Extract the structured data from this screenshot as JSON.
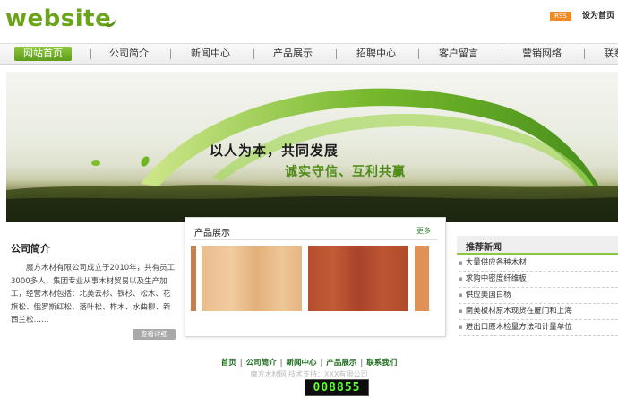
{
  "header": {
    "logo_text": "website",
    "rss_label": "RSS",
    "set_home": "设为首页"
  },
  "nav": {
    "items": [
      {
        "label": "网站首页",
        "active": true
      },
      {
        "label": "公司简介"
      },
      {
        "label": "新闻中心"
      },
      {
        "label": "产品展示"
      },
      {
        "label": "招聘中心"
      },
      {
        "label": "客户留言"
      },
      {
        "label": "营销网络"
      },
      {
        "label": "联系"
      }
    ]
  },
  "banner": {
    "slogan_main": "以人为本，共同发展",
    "slogan_sub": "诚实守信、互利共赢"
  },
  "about": {
    "title": "公司简介",
    "text": "魔方木材有限公司成立于2010年，共有员工3000多人，集团专业从事木材贸易以及生产加工，经营木材包括：北美云杉、铁杉、松木、花旗松、俄罗斯红松、落叶松、柞木、水曲柳、新西兰松……",
    "more_label": "查看详细"
  },
  "products": {
    "title": "产品展示",
    "more_label": "更多",
    "colors": {
      "wood_light": "#e8b884",
      "wood_red": "#b34c2c",
      "wood_orange": "#e0925a"
    }
  },
  "news": {
    "title": "推荐新闻",
    "items": [
      "大量供应各种木材",
      "求购中密度纤维板",
      "供应美国白杨",
      "南美板材原木现货在厦门和上海",
      "进出口原木检量方法和计量单位"
    ]
  },
  "footer": {
    "links": [
      "首页",
      "公司简介",
      "新闻中心",
      "产品展示",
      "联系我们"
    ],
    "copyright": "魔方木材网    技术支持：XXX有限公司",
    "counter": "008855"
  },
  "theme": {
    "accent": "#8ec63f",
    "brand_green": "#6aa519"
  }
}
